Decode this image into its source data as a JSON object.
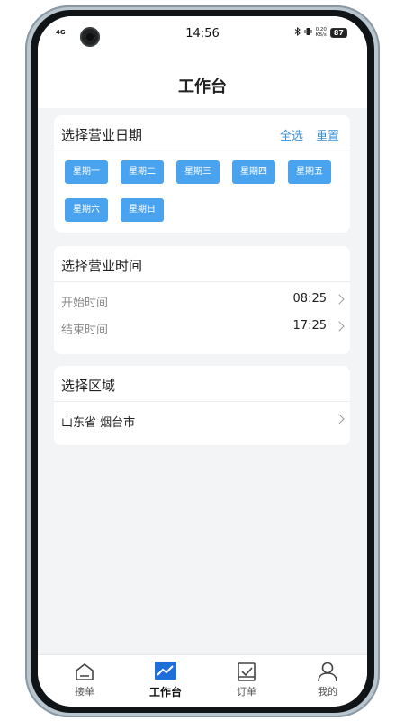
{
  "status_bar": {
    "signal": "4G",
    "time": "14:56",
    "net_speed_value": "0.20",
    "net_speed_unit": "KB/s",
    "battery": "87"
  },
  "header": {
    "title": "工作台"
  },
  "date_section": {
    "title": "选择营业日期",
    "select_all": "全选",
    "reset": "重置",
    "days": [
      "星期一",
      "星期二",
      "星期三",
      "星期四",
      "星期五",
      "星期六",
      "星期日"
    ]
  },
  "time_section": {
    "title": "选择营业时间",
    "start_label": "开始时间",
    "start_value": "08:25",
    "end_label": "结束时间",
    "end_value": "17:25"
  },
  "region_section": {
    "title": "选择区域",
    "value": "山东省 烟台市"
  },
  "tabbar": {
    "items": [
      {
        "label": "接单",
        "icon": "home-icon"
      },
      {
        "label": "工作台",
        "icon": "chart-icon",
        "active": true
      },
      {
        "label": "订单",
        "icon": "order-icon"
      },
      {
        "label": "我的",
        "icon": "user-icon"
      }
    ]
  },
  "colors": {
    "accent": "#4aa3ee",
    "link": "#3b8fd8",
    "active_tab": "#1e6fd9"
  }
}
